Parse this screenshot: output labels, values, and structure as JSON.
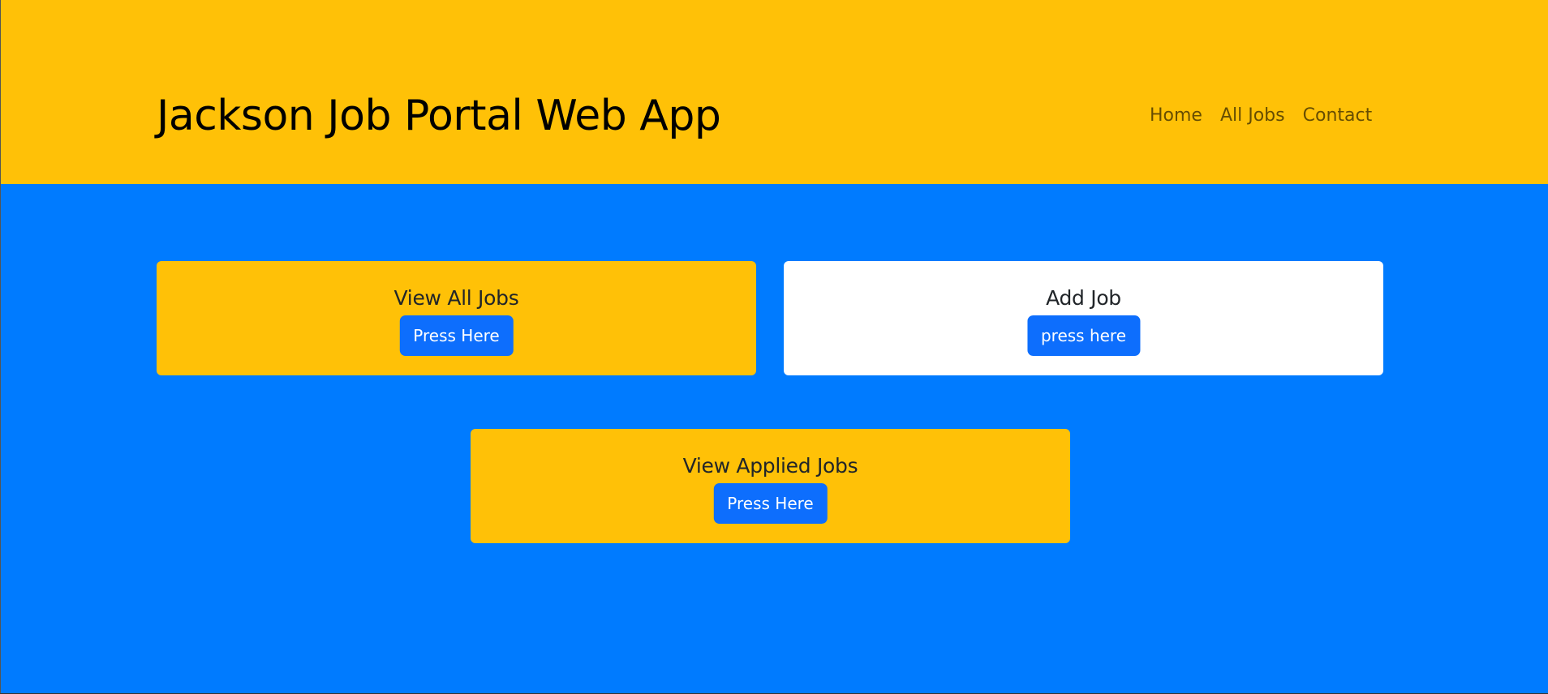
{
  "header": {
    "title": "Jackson Job Portal Web App",
    "nav": [
      {
        "label": "Home"
      },
      {
        "label": "All Jobs"
      },
      {
        "label": "Contact"
      }
    ]
  },
  "cards": [
    {
      "title": "View All Jobs",
      "button_label": "Press Here"
    },
    {
      "title": "Add Job",
      "button_label": "press here"
    },
    {
      "title": "View Applied Jobs",
      "button_label": "Press Here"
    }
  ],
  "colors": {
    "header_bg": "#ffc107",
    "page_bg": "#007bff",
    "button_bg": "#0d6efd",
    "card_yellow": "#ffc107",
    "card_white": "#ffffff"
  }
}
